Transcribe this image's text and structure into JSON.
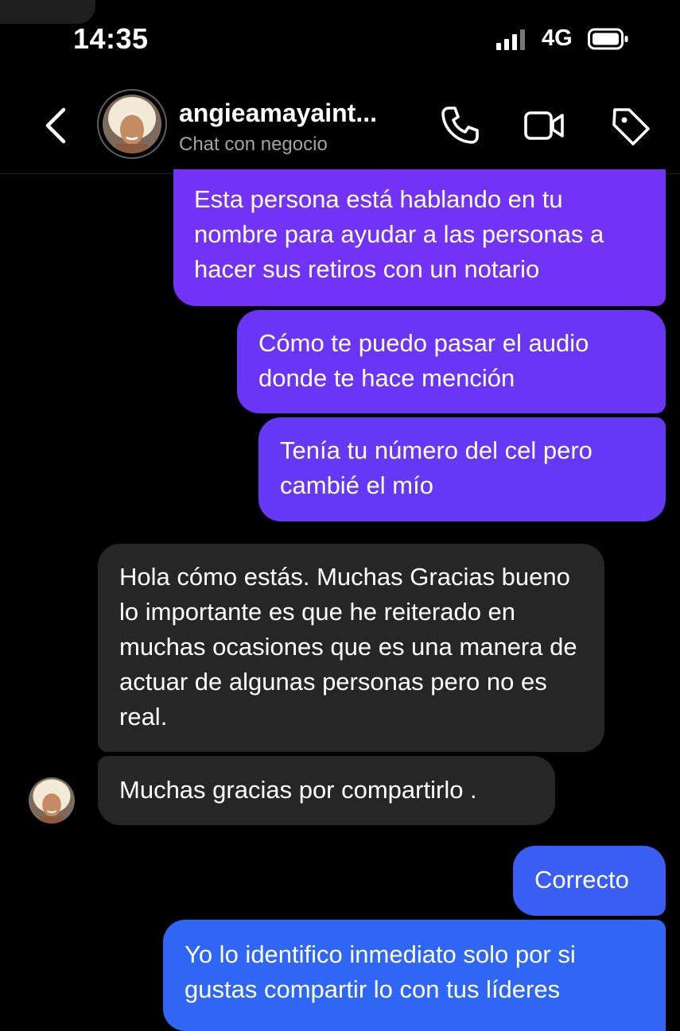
{
  "status_bar": {
    "time": "14:35",
    "network": "4G"
  },
  "header": {
    "contact_name": "angieamayaint...",
    "subtitle": "Chat con negocio",
    "icons": [
      "chevron-left-icon",
      "phone-icon",
      "video-camera-icon",
      "tag-icon"
    ]
  },
  "colors": {
    "background": "#000000",
    "incoming_bubble": "#262626",
    "outgoing_bubble_top": "#7231f5",
    "outgoing_bubble_bottom": "#2f64f4",
    "secondary_text": "#a3a3a3"
  },
  "messages": [
    {
      "direction": "outgoing",
      "text": "Esta persona está hablando en tu nombre para ayudar a las personas a hacer sus retiros con un notario"
    },
    {
      "direction": "outgoing",
      "text": "Cómo te puedo pasar el audio donde te hace mención"
    },
    {
      "direction": "outgoing",
      "text": "Tenía tu número del cel pero cambié el mío"
    },
    {
      "direction": "incoming",
      "text": "Hola cómo estás. Muchas Gracias bueno lo importante es que he reiterado en muchas ocasiones que es una manera de actuar de algunas personas pero no es real."
    },
    {
      "direction": "incoming",
      "text": "Muchas gracias por compartirlo ."
    },
    {
      "direction": "outgoing",
      "text": "Correcto"
    },
    {
      "direction": "outgoing",
      "text": "Yo lo identifico inmediato solo por si gustas compartir lo con tus líderes"
    }
  ]
}
